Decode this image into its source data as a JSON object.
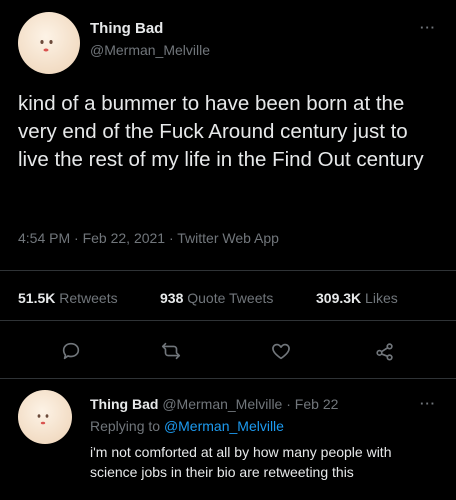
{
  "tweet": {
    "display_name": "Thing Bad",
    "handle": "@Merman_Melville",
    "more": "···",
    "text": "kind of a bummer to have been born at the very end of the Fuck Around century just to live the rest of my life in the Find Out century",
    "meta": "4:54 PM · Feb 22, 2021 · Twitter Web App",
    "stats": {
      "retweets_count": "51.5K",
      "retweets_label": "Retweets",
      "quotes_count": "938",
      "quotes_label": "Quote Tweets",
      "likes_count": "309.3K",
      "likes_label": "Likes"
    },
    "actions": [
      "reply-icon",
      "retweet-icon",
      "like-icon",
      "share-icon"
    ]
  },
  "reply": {
    "display_name": "Thing Bad",
    "handle": "@Merman_Melville",
    "date": "· Feb 22",
    "more": "···",
    "replying_prefix": "Replying to",
    "replying_to": "@Merman_Melville",
    "text": "i'm not comforted at all by how many people with science jobs in their bio are retweeting this"
  },
  "colors": {
    "background": "#000000",
    "text": "#e7e9ea",
    "secondary": "#71767b",
    "link": "#1d9bf0",
    "divider": "#2f3336"
  }
}
